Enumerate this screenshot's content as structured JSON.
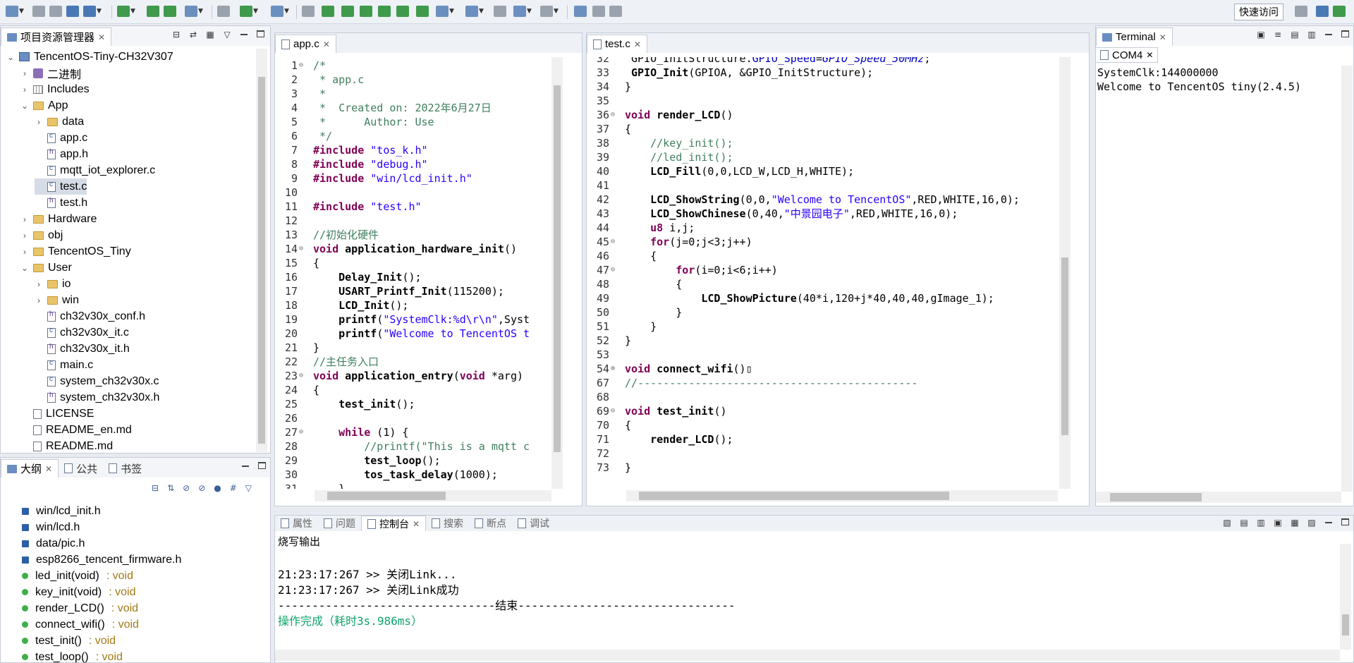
{
  "toolbar": {
    "quick_access": "快速访问"
  },
  "explorer": {
    "title": "项目资源管理器",
    "items": [
      {
        "label": "TencentOS-Tiny-CH32V307",
        "type": "project"
      },
      {
        "label": "二进制",
        "type": "bin"
      },
      {
        "label": "Includes",
        "type": "inc"
      },
      {
        "label": "App",
        "type": "folder"
      },
      {
        "label": "data",
        "type": "folder"
      },
      {
        "label": "app.c",
        "type": "c"
      },
      {
        "label": "app.h",
        "type": "h"
      },
      {
        "label": "mqtt_iot_explorer.c",
        "type": "c"
      },
      {
        "label": "test.c",
        "type": "c"
      },
      {
        "label": "test.h",
        "type": "h"
      },
      {
        "label": "Hardware",
        "type": "folder"
      },
      {
        "label": "obj",
        "type": "folder"
      },
      {
        "label": "TencentOS_Tiny",
        "type": "folder"
      },
      {
        "label": "User",
        "type": "folder"
      },
      {
        "label": "io",
        "type": "folder"
      },
      {
        "label": "win",
        "type": "folder"
      },
      {
        "label": "ch32v30x_conf.h",
        "type": "h"
      },
      {
        "label": "ch32v30x_it.c",
        "type": "c"
      },
      {
        "label": "ch32v30x_it.h",
        "type": "h"
      },
      {
        "label": "main.c",
        "type": "c"
      },
      {
        "label": "system_ch32v30x.c",
        "type": "c"
      },
      {
        "label": "system_ch32v30x.h",
        "type": "h"
      },
      {
        "label": "LICENSE",
        "type": "file"
      },
      {
        "label": "README_en.md",
        "type": "file"
      },
      {
        "label": "README.md",
        "type": "file"
      }
    ]
  },
  "outline": {
    "tabs": [
      "大纲",
      "公共",
      "书签"
    ],
    "items": [
      {
        "name": "win/lcd_init.h",
        "type": ""
      },
      {
        "name": "win/lcd.h",
        "type": ""
      },
      {
        "name": "data/pic.h",
        "type": ""
      },
      {
        "name": "esp8266_tencent_firmware.h",
        "type": ""
      },
      {
        "name": "led_init(void)",
        "type": " : void"
      },
      {
        "name": "key_init(void)",
        "type": " : void"
      },
      {
        "name": "render_LCD()",
        "type": " : void"
      },
      {
        "name": "connect_wifi()",
        "type": " : void"
      },
      {
        "name": "test_init()",
        "type": " : void"
      },
      {
        "name": "test_loop()",
        "type": " : void"
      }
    ]
  },
  "editor1": {
    "tab": "app.c",
    "lines": [
      {
        "n": "1",
        "html": "<span class=\"cm\">/*</span>"
      },
      {
        "n": "2",
        "html": "<span class=\"cm\"> * app.c</span>"
      },
      {
        "n": "3",
        "html": "<span class=\"cm\"> *</span>"
      },
      {
        "n": "4",
        "html": "<span class=\"cm\"> *  Created on: 2022年6月27日</span>"
      },
      {
        "n": "5",
        "html": "<span class=\"cm\"> *      Author: Use</span>"
      },
      {
        "n": "6",
        "html": "<span class=\"cm\"> */</span>"
      },
      {
        "n": "7",
        "html": "<span class=\"pre\">#include</span> <span class=\"str\">\"tos_k.h\"</span>"
      },
      {
        "n": "8",
        "html": "<span class=\"pre\">#include</span> <span class=\"str\">\"debug.h\"</span>"
      },
      {
        "n": "9",
        "html": "<span class=\"pre\">#include</span> <span class=\"str\">\"win/lcd_init.h\"</span>"
      },
      {
        "n": "10",
        "html": ""
      },
      {
        "n": "11",
        "html": "<span class=\"pre\">#include</span> <span class=\"str\">\"test.h\"</span>"
      },
      {
        "n": "12",
        "html": ""
      },
      {
        "n": "13",
        "html": "<span class=\"cm\">//初始化硬件</span>"
      },
      {
        "n": "14",
        "html": "<span class=\"kw\">void</span> <span class=\"fn\">application_hardware_init</span>()"
      },
      {
        "n": "15",
        "html": "{"
      },
      {
        "n": "16",
        "html": "    <span class=\"fn\">Delay_Init</span>();"
      },
      {
        "n": "17",
        "html": "    <span class=\"fn\">USART_Printf_Init</span>(115200);"
      },
      {
        "n": "18",
        "html": "    <span class=\"fn\">LCD_Init</span>();"
      },
      {
        "n": "19",
        "html": "    <span class=\"fn\">printf</span>(<span class=\"str\">\"SystemClk:%d\\r\\n\"</span>,Syst"
      },
      {
        "n": "20",
        "html": "    <span class=\"fn\">printf</span>(<span class=\"str\">\"Welcome to TencentOS t</span>"
      },
      {
        "n": "21",
        "html": "}"
      },
      {
        "n": "22",
        "html": "<span class=\"cm\">//主任务入口</span>"
      },
      {
        "n": "23",
        "html": "<span class=\"kw\">void</span> <span class=\"fn\">application_entry</span>(<span class=\"kw\">void</span> *arg)"
      },
      {
        "n": "24",
        "html": "{"
      },
      {
        "n": "25",
        "html": "    <span class=\"fn\">test_init</span>();"
      },
      {
        "n": "26",
        "html": ""
      },
      {
        "n": "27",
        "html": "    <span class=\"kw\">while</span> (1) {"
      },
      {
        "n": "28",
        "html": "        <span class=\"cm\">//printf(\"This is a mqtt c</span>"
      },
      {
        "n": "29",
        "html": "        <span class=\"fn\">test_loop</span>();"
      },
      {
        "n": "30",
        "html": "        <span class=\"fn\">tos_task_delay</span>(1000);"
      },
      {
        "n": "31",
        "html": "    }"
      }
    ]
  },
  "editor2": {
    "tab": "test.c",
    "lines": [
      {
        "n": "32",
        "html": " GPIO_InitStructure.<span class=\"var\">GPIO_Speed</span>=<span class=\"mac\">GPIO_Speed_50MHz</span>;"
      },
      {
        "n": "33",
        "html": " <span class=\"fn\">GPIO_Init</span>(GPIOA, &amp;GPIO_InitStructure);"
      },
      {
        "n": "34",
        "html": "}"
      },
      {
        "n": "35",
        "html": ""
      },
      {
        "n": "36",
        "html": "<span class=\"kw\">void</span> <span class=\"fn\">render_LCD</span>()"
      },
      {
        "n": "37",
        "html": "{"
      },
      {
        "n": "38",
        "html": "    <span class=\"cm\">//key_init();</span>"
      },
      {
        "n": "39",
        "html": "    <span class=\"cm\">//led_init();</span>"
      },
      {
        "n": "40",
        "html": "    <span class=\"fn\">LCD_Fill</span>(0,0,LCD_W,LCD_H,WHITE);"
      },
      {
        "n": "41",
        "html": ""
      },
      {
        "n": "42",
        "html": "    <span class=\"fn\">LCD_ShowString</span>(0,0,<span class=\"str\">\"Welcome to TencentOS\"</span>,RED,WHITE,16,0);"
      },
      {
        "n": "43",
        "html": "    <span class=\"fn\">LCD_ShowChinese</span>(0,40,<span class=\"str\">\"中景园电子\"</span>,RED,WHITE,16,0);"
      },
      {
        "n": "44",
        "html": "    <span class=\"kw\">u8</span> i,j;"
      },
      {
        "n": "45",
        "html": "    <span class=\"kw\">for</span>(j=0;j&lt;3;j++)"
      },
      {
        "n": "46",
        "html": "    {"
      },
      {
        "n": "47",
        "html": "        <span class=\"kw\">for</span>(i=0;i&lt;6;i++)"
      },
      {
        "n": "48",
        "html": "        {"
      },
      {
        "n": "49",
        "html": "            <span class=\"fn\">LCD_ShowPicture</span>(40*i,120+j*40,40,40,gImage_1);"
      },
      {
        "n": "50",
        "html": "        }"
      },
      {
        "n": "51",
        "html": "    }"
      },
      {
        "n": "52",
        "html": "}"
      },
      {
        "n": "53",
        "html": ""
      },
      {
        "n": "54",
        "html": "<span class=\"kw\">void</span> <span class=\"fn\">connect_wifi</span>()▯"
      },
      {
        "n": "67",
        "html": "<span class=\"cm\">//--------------------------------------------</span>"
      },
      {
        "n": "68",
        "html": ""
      },
      {
        "n": "69",
        "html": "<span class=\"kw\">void</span> <span class=\"fn\">test_init</span>()"
      },
      {
        "n": "70",
        "html": "{"
      },
      {
        "n": "71",
        "html": "    <span class=\"fn\">render_LCD</span>();"
      },
      {
        "n": "72",
        "html": ""
      },
      {
        "n": "73",
        "html": "}"
      }
    ]
  },
  "terminal": {
    "title": "Terminal",
    "subtab": "COM4",
    "lines": [
      "SystemClk:144000000",
      "Welcome to TencentOS tiny(2.4.5)"
    ]
  },
  "bottom": {
    "tabs": [
      "属性",
      "问题",
      "控制台",
      "搜索",
      "断点",
      "调试"
    ],
    "title": "烧写输出",
    "lines": [
      "21:23:17:267 >> 关闭Link...",
      "21:23:17:267 >> 关闭Link成功",
      "--------------------------------结束--------------------------------"
    ],
    "result": "操作完成（耗时3s.986ms）"
  }
}
